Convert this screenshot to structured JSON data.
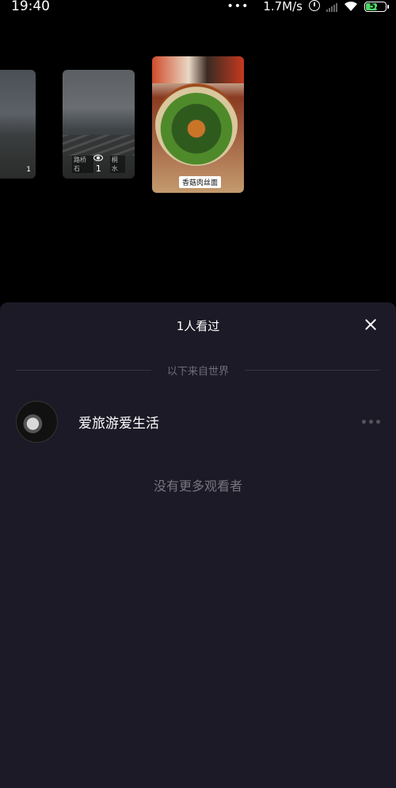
{
  "status_bar": {
    "time": "19:40",
    "dots": "•••",
    "speed": "1.7M/s",
    "battery": "52",
    "battery_color": "#4cd964"
  },
  "stories": [
    {
      "badge": "1"
    },
    {
      "tag_left": "路桥石",
      "count": "1",
      "tag_right": "桐水"
    },
    {
      "label": "香菇肉丝面"
    }
  ],
  "sheet": {
    "title": "1人看过",
    "divider_text": "以下来自世界",
    "viewers": [
      {
        "name": "爱旅游爱生活"
      }
    ],
    "empty_text": "没有更多观看者",
    "background": "#1b1a26"
  },
  "icons": [
    "alarm-icon",
    "signal-icon",
    "wifi-icon",
    "battery-icon",
    "eye-icon",
    "close-icon",
    "more-icon"
  ]
}
